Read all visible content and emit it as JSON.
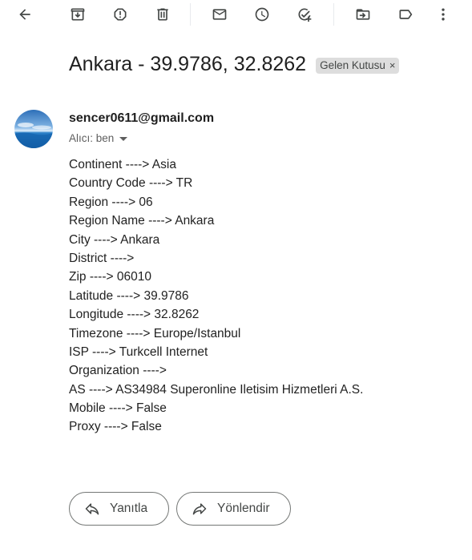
{
  "toolbar": {
    "buttons": [
      {
        "name": "back-button",
        "icon": "arrow-left-icon",
        "label": ""
      },
      {
        "name": "archive-button",
        "icon": "archive-icon",
        "label": ""
      },
      {
        "name": "report-spam-button",
        "icon": "report-spam-icon",
        "label": ""
      },
      {
        "name": "delete-button",
        "icon": "trash-icon",
        "label": ""
      },
      {
        "name": "mark-unread-button",
        "icon": "envelope-icon",
        "label": ""
      },
      {
        "name": "snooze-button",
        "icon": "clock-icon",
        "label": ""
      },
      {
        "name": "add-to-tasks-button",
        "icon": "add-task-icon",
        "label": ""
      },
      {
        "name": "move-to-button",
        "icon": "move-to-folder-icon",
        "label": ""
      },
      {
        "name": "labels-button",
        "icon": "label-icon",
        "label": ""
      },
      {
        "name": "more-button",
        "icon": "more-vert-icon",
        "label": ""
      }
    ]
  },
  "email": {
    "subject": "Ankara - 39.9786, 32.8262",
    "label_chip": "Gelen Kutusu",
    "label_chip_close": "×",
    "sender": "sencer0611@gmail.com",
    "recipient": "Alıcı: ben",
    "body_lines": [
      "Continent ----> Asia",
      "Country Code ----> TR",
      "Region ----> 06",
      "Region Name ----> Ankara",
      "City ----> Ankara",
      "District ---->",
      "Zip ----> 06010",
      "Latitude ----> 39.9786",
      "Longitude ----> 32.8262",
      "Timezone ----> Europe/Istanbul",
      "ISP ----> Turkcell Internet",
      "Organization ---->",
      "AS ----> AS34984 Superonline Iletisim Hizmetleri A.S.",
      "Mobile ----> False",
      "Proxy ----> False"
    ]
  },
  "actions": {
    "reply_label": "Yanıtla",
    "forward_label": "Yönlendir"
  },
  "colors": {
    "icon": "#444746",
    "chip_bg": "#dddddd",
    "border": "#747775"
  }
}
